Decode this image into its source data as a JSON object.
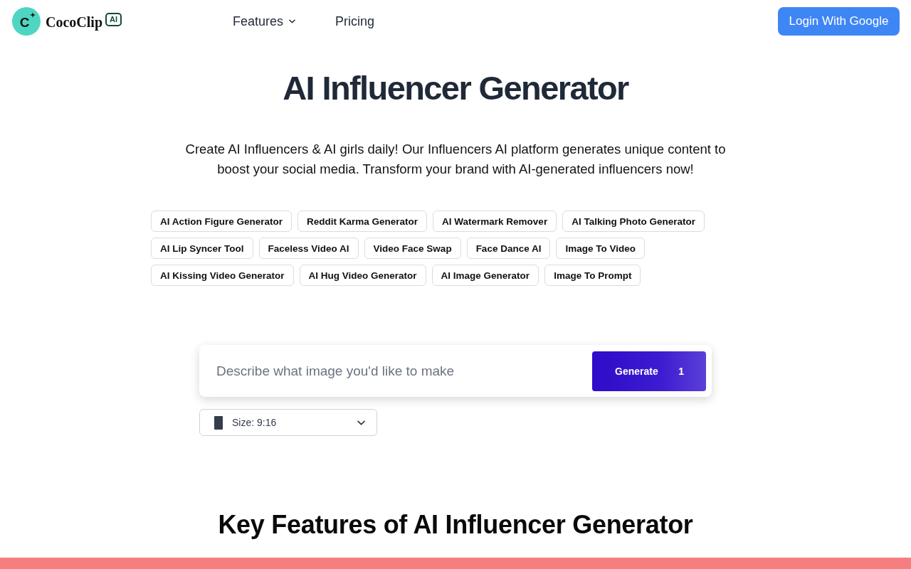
{
  "header": {
    "logo": {
      "mark": "C",
      "name": "CocoClip",
      "badge": "AI"
    },
    "nav": [
      {
        "label": "Features",
        "kind": "dropdown"
      },
      {
        "label": "Pricing",
        "kind": "link"
      }
    ],
    "login_button": "Login With Google"
  },
  "hero": {
    "title": "AI Influencer Generator",
    "description": "Create AI Influencers & AI girls daily! Our Influencers AI platform generates unique content to boost your social media. Transform your brand with AI-generated influencers now!",
    "tool_links": [
      "AI Action Figure Generator",
      "Reddit Karma Generator",
      "AI Watermark Remover",
      "AI Talking Photo Generator",
      "AI Lip Syncer Tool",
      "Faceless Video AI",
      "Video Face Swap",
      "Face Dance AI",
      "Image To Video",
      "AI Kissing Video Generator",
      "AI Hug Video Generator",
      "AI Image Generator",
      "Image To Prompt"
    ]
  },
  "prompt": {
    "placeholder": "Describe what image you'd like to make",
    "generate_button": {
      "label": "Generate",
      "count": "1"
    }
  },
  "size_select": {
    "value": "Size: 9:16"
  },
  "features_section": {
    "title": "Key Features of AI Influencer Generator"
  }
}
